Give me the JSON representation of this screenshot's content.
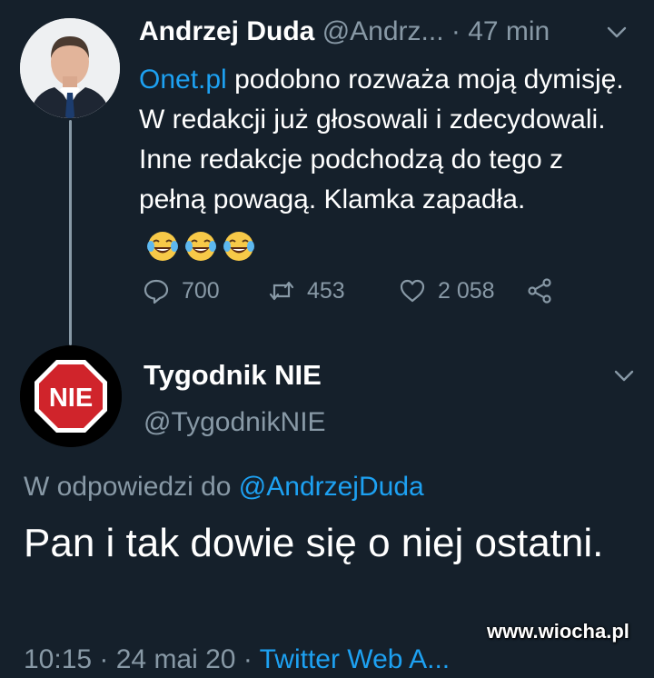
{
  "tweet1": {
    "display_name": "Andrzej Duda",
    "handle": "@Andrz...",
    "time": "· 47 min",
    "link_text": "Onet.pl",
    "text": " podobno rozważa moją dymisję. W redakcji już głosowali i zdecydowali. Inne redakcje podchodzą do tego z pełną powagą. Klamka zapadła.",
    "emoji": "face-with-tears-of-joy x3",
    "replies": "700",
    "retweets": "453",
    "likes": "2 058"
  },
  "tweet2": {
    "display_name": "Tygodnik NIE",
    "handle": "@TygodnikNIE",
    "avatar_text": "NIE",
    "reply_prefix": "W odpowiedzi do ",
    "reply_to": "@AndrzejDuda",
    "text": "Pan i tak dowie się o niej ostatni.",
    "meta_time": "10:15 · 24 mai 20 · ",
    "meta_source": "Twitter Web A..."
  },
  "watermark": "www.wiocha.pl",
  "colors": {
    "background": "#15202b",
    "muted": "#8899a6",
    "link": "#1da1f2",
    "stop_sign": "#d0242b"
  }
}
